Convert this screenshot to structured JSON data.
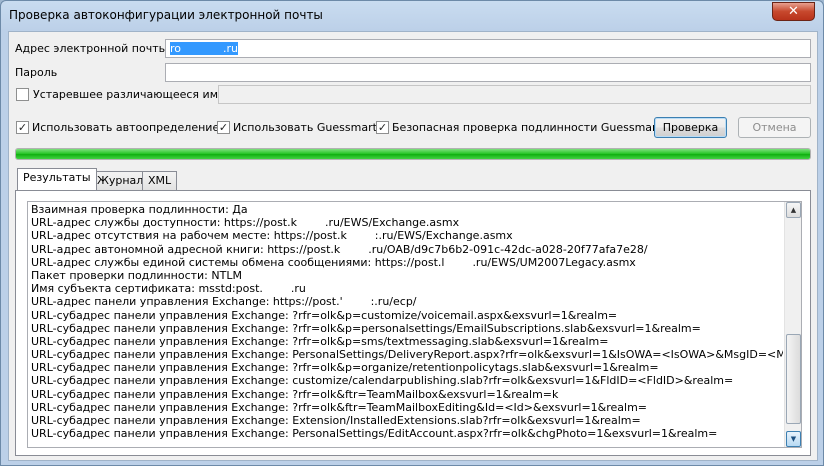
{
  "window": {
    "title": "Проверка автоконфигурации электронной почты",
    "close_glyph": "✕"
  },
  "form": {
    "email_label": "Адрес электронной почты",
    "email_value_start": "ro",
    "email_value_masked": "            ",
    "email_value_end": ".ru",
    "password_label": "Пароль",
    "password_value": "",
    "legacy_label": "Устаревшее различающееся имя",
    "legacy_value": "",
    "legacy_checked": false
  },
  "options": {
    "use_autodiscover_label": "Использовать автоопределение",
    "use_autodiscover_checked": true,
    "use_guessmart_label": "Использовать Guessmart",
    "use_guessmart_checked": true,
    "secure_guessmart_label": "Безопасная проверка подлинности Guessmart",
    "secure_guessmart_checked": true,
    "check_mark": "✓"
  },
  "buttons": {
    "test": "Проверка",
    "cancel": "Отмена"
  },
  "progress": {
    "value": 1.0,
    "color": "#22c322"
  },
  "tabs": [
    {
      "label": "Результаты",
      "active": true
    },
    {
      "label": "Журнал",
      "active": false
    },
    {
      "label": "XML",
      "active": false
    }
  ],
  "results": {
    "lines": [
      "Взаимная проверка подлинности: Да",
      "URL-адрес службы доступности: https://post.k        .ru/EWS/Exchange.asmx",
      "URL-адрес отсутствия на рабочем месте: https://post.k        :.ru/EWS/Exchange.asmx",
      "URL-адрес автономной адресной книги: https://post.k        .ru/OAB/d9c7b6b2-091c-42dc-a028-20f77afa7e28/",
      "URL-адрес службы единой системы обмена сообщениями: https://post.l        .ru/EWS/UM2007Legacy.asmx",
      "Пакет проверки подлинности: NTLM",
      "Имя субъекта сертификата: msstd:post.        .ru",
      "URL-адрес панели управления Exchange: https://post.'        :.ru/ecp/",
      "URL-субадрес панели управления Exchange: ?rfr=olk&p=customize/voicemail.aspx&exsvurl=1&realm=",
      "URL-субадрес панели управления Exchange: ?rfr=olk&p=personalsettings/EmailSubscriptions.slab&exsvurl=1&realm=",
      "URL-субадрес панели управления Exchange: ?rfr=olk&p=sms/textmessaging.slab&exsvurl=1&realm=",
      "URL-субадрес панели управления Exchange: PersonalSettings/DeliveryReport.aspx?rfr=olk&exsvurl=1&IsOWA=<IsOWA>&MsgID=<MsgID>&Mb",
      "URL-субадрес панели управления Exchange: ?rfr=olk&p=organize/retentionpolicytags.slab&exsvurl=1&realm=",
      "URL-субадрес панели управления Exchange: customize/calendarpublishing.slab?rfr=olk&exsvurl=1&FldID=<FldID>&realm=",
      "URL-субадрес панели управления Exchange: ?rfr=olk&ftr=TeamMailbox&exsvurl=1&realm=k",
      "URL-субадрес панели управления Exchange: ?rfr=olk&ftr=TeamMailboxEditing&Id=<Id>&exsvurl=1&realm=",
      "URL-субадрес панели управления Exchange: Extension/InstalledExtensions.slab?rfr=olk&exsvurl=1&realm=",
      "URL-субадрес панели управления Exchange: PersonalSettings/EditAccount.aspx?rfr=olk&chgPhoto=1&exsvurl=1&realm="
    ]
  },
  "scrollbar": {
    "up_glyph": "▲",
    "down_glyph": "▼"
  }
}
